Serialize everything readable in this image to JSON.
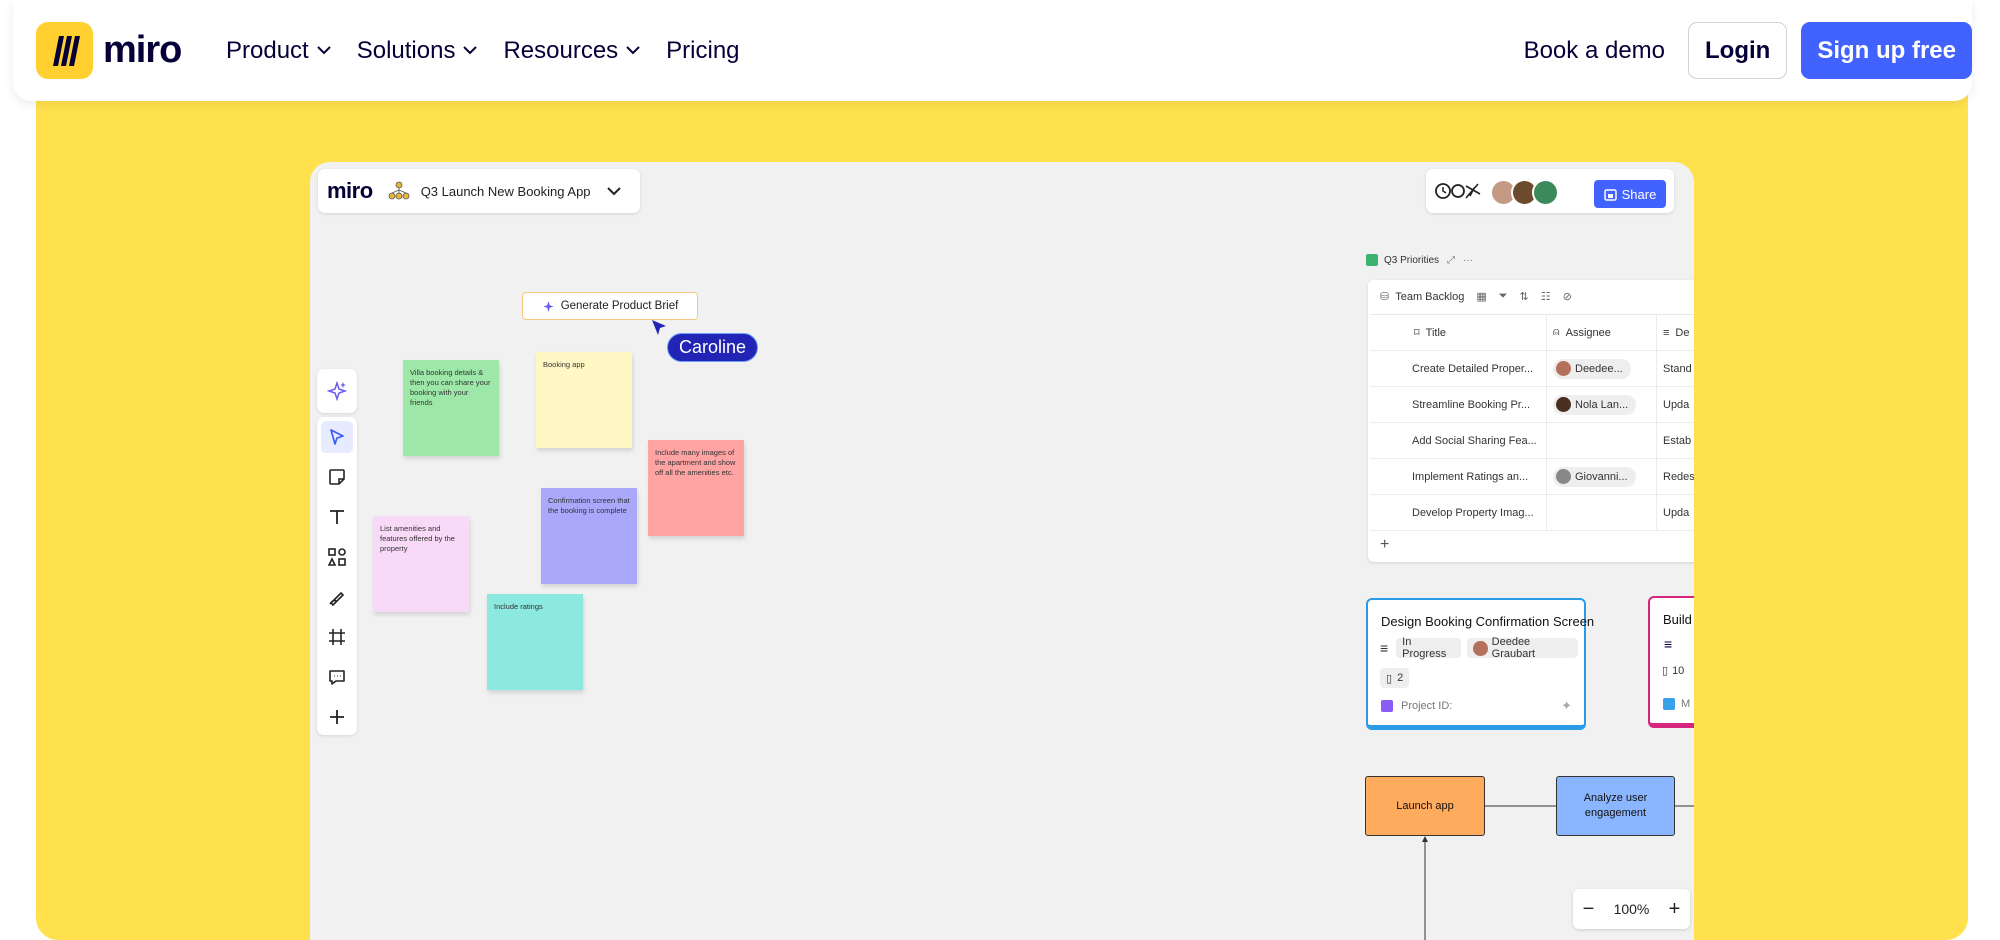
{
  "nav": {
    "brand": "miro",
    "links": [
      "Product",
      "Solutions",
      "Resources",
      "Pricing"
    ],
    "book_demo": "Book a demo",
    "login": "Login",
    "signup": "Sign up free"
  },
  "board": {
    "logo": "miro",
    "name": "Q3 Launch New Booking App",
    "share": "Share",
    "generate_brief": "Generate Product Brief",
    "cursor_user": "Caroline",
    "stickies": [
      "Villa booking details & then you can share your booking with your friends",
      "Booking app",
      "Include many images of the apartment and show off all the amenities etc.",
      "Confirmation screen that the booking is complete",
      "List amenities and features offered by the property",
      "Include ratings"
    ],
    "zoom": "100%"
  },
  "table": {
    "title": "Q3 Priorities",
    "view": "Team Backlog",
    "columns": [
      "Title",
      "Assignee",
      "De"
    ],
    "rows": [
      {
        "title": "Create Detailed Proper...",
        "assignee": "Deedee...",
        "desc": "Stand"
      },
      {
        "title": "Streamline Booking Pr...",
        "assignee": "Nola Lan...",
        "desc": "Upda"
      },
      {
        "title": "Add Social Sharing Fea...",
        "assignee": "",
        "desc": "Estab"
      },
      {
        "title": "Implement Ratings an...",
        "assignee": "Giovanni...",
        "desc": "Redes"
      },
      {
        "title": "Develop Property Imag...",
        "assignee": "",
        "desc": "Upda"
      }
    ],
    "add": "+"
  },
  "cards": {
    "blue": {
      "title": "Design Booking Confirmation Screen",
      "status": "In Progress",
      "assignee": "Deedee Graubart",
      "count": "2",
      "project": "Project ID:"
    },
    "pink": {
      "title": "Build",
      "count": "10",
      "footer": "M"
    }
  },
  "flow": {
    "launch": "Launch app",
    "analyze": "Analyze user engagement"
  },
  "colors": {
    "brand_yellow": "#FFD02F",
    "hero_yellow": "#FFE14D",
    "accent_blue": "#4262FF",
    "sticky_green": "#9de8a8",
    "sticky_yellow": "#fff8c4",
    "sticky_red": "#ffa3a3",
    "sticky_purple": "#a9a8fb",
    "sticky_pink": "#f9d9f8",
    "sticky_teal": "#8ce9df",
    "flow_orange": "#ffab5e",
    "flow_blue": "#8ab6ff"
  }
}
